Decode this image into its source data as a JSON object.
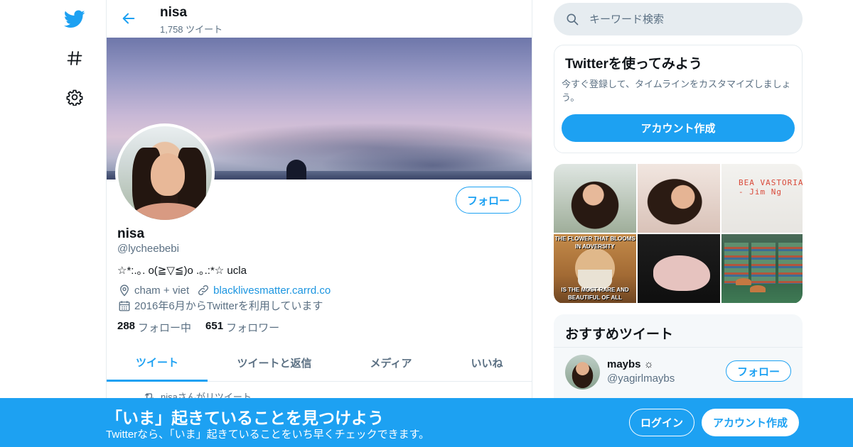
{
  "colors": {
    "accent": "#1da1f2",
    "link": "#1b95e0",
    "muted": "#5b7083",
    "border": "#e6ecf0"
  },
  "nav": {
    "icons": [
      "twitter-bird-icon",
      "hashtag-icon",
      "gear-icon"
    ]
  },
  "header": {
    "name": "nisa",
    "tweet_count": "1,758 ツイート"
  },
  "profile": {
    "name": "nisa",
    "handle": "@lycheebebi",
    "bio": "☆*:.｡. o(≧▽≦)o .｡.:*☆ ucla",
    "location": "cham + viet",
    "website": "blacklivesmatter.carrd.co",
    "joined": "2016年6月からTwitterを利用しています",
    "following_count": "288",
    "following_label": "フォロー中",
    "followers_count": "651",
    "followers_label": "フォロワー",
    "follow_label": "フォロー"
  },
  "tabs": [
    {
      "label": "ツイート",
      "active": true
    },
    {
      "label": "ツイートと返信",
      "active": false
    },
    {
      "label": "メディア",
      "active": false
    },
    {
      "label": "いいね",
      "active": false
    }
  ],
  "feed": {
    "retweet_note": "nisaさんがリツイート"
  },
  "search": {
    "placeholder": "キーワード検索"
  },
  "signup_card": {
    "title": "Twitterを使ってみよう",
    "description": "今すぐ登録して、タイムラインをカスタマイズしましょう。",
    "button": "アカウント作成"
  },
  "media_grid": {
    "captions": {
      "t3_scrawl": "BEA VASTORIA - Jim Ng",
      "t4_top": "THE FLOWER THAT BLOOMS IN ADVERSITY",
      "t4_bottom_1": "IS THE MOST RARE AND",
      "t4_bottom_2": "BEAUTIFUL OF ALL"
    }
  },
  "recommended": {
    "title": "おすすめツイート",
    "user": {
      "name": "maybs ☼",
      "handle": "@yagirlmaybs",
      "follow_label": "フォロー"
    }
  },
  "bottom_bar": {
    "title": "「いま」起きていることを見つけよう",
    "subtitle": "Twitterなら、「いま」起きていることをいち早くチェックできます。",
    "login": "ログイン",
    "create": "アカウント作成"
  }
}
